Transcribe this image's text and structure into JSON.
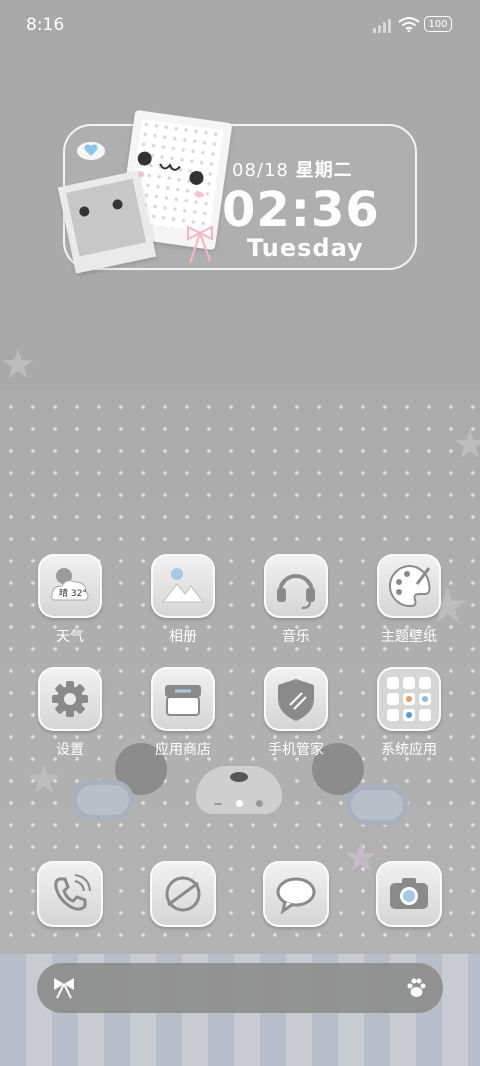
{
  "status_bar": {
    "time": "8:16",
    "battery": "100"
  },
  "widget": {
    "date": "08/18",
    "weekday_cn": "星期二",
    "time": "02:36",
    "weekday_en": "Tuesday"
  },
  "apps_row1": [
    {
      "label": "天气",
      "icon": "weather-icon",
      "temp": "晴 32°"
    },
    {
      "label": "相册",
      "icon": "gallery-icon"
    },
    {
      "label": "音乐",
      "icon": "headphones-icon"
    },
    {
      "label": "主题壁纸",
      "icon": "palette-icon"
    }
  ],
  "apps_row2": [
    {
      "label": "设置",
      "icon": "gear-icon"
    },
    {
      "label": "应用商店",
      "icon": "store-icon"
    },
    {
      "label": "手机管家",
      "icon": "shield-icon"
    },
    {
      "label": "系统应用",
      "icon": "folder-icon"
    }
  ],
  "dock": [
    {
      "icon": "phone-icon"
    },
    {
      "icon": "browser-icon"
    },
    {
      "icon": "message-icon"
    },
    {
      "icon": "camera-icon"
    }
  ],
  "search_bar": {
    "left_icon": "bow-icon",
    "right_icon": "paw-icon"
  }
}
